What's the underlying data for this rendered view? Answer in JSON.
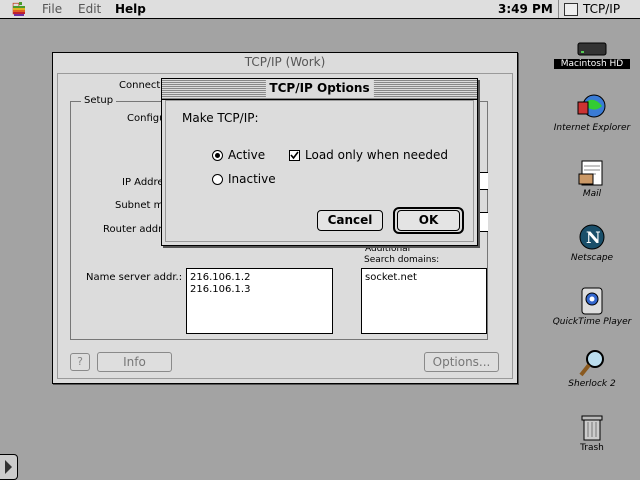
{
  "menubar": {
    "menus": [
      "File",
      "Edit",
      "Help"
    ],
    "clock": "3:49 PM",
    "active_app": "TCP/IP"
  },
  "main_window": {
    "title": "TCP/IP (Work)",
    "connect_label": "Connect v",
    "setup_label": "Setup",
    "configure_label": "Configu",
    "ip_address_label": "IP Addre",
    "subnet_mask_label": "Subnet ma",
    "router_address_label": "Router addre",
    "additional_label": "Additional",
    "search_domains_label": "Search domains:",
    "name_server_label": "Name server addr.:",
    "name_servers": [
      "216.106.1.2",
      "216.106.1.3"
    ],
    "search_domains": [
      "socket.net"
    ],
    "help_label": "?",
    "info_label": "Info",
    "options_label": "Options..."
  },
  "dialog": {
    "title": "TCP/IP Options",
    "prompt": "Make TCP/IP:",
    "radio_active": "Active",
    "radio_inactive": "Inactive",
    "selected": "Active",
    "checkbox_label": "Load only when needed",
    "checkbox_checked": true,
    "cancel_label": "Cancel",
    "ok_label": "OK"
  },
  "desktop_icons": [
    {
      "name": "Macintosh HD",
      "icon": "hard-disk-icon",
      "selected": true
    },
    {
      "name": "Internet Explorer",
      "icon": "internet-explorer-icon"
    },
    {
      "name": "Mail",
      "icon": "mail-icon"
    },
    {
      "name": "Netscape",
      "icon": "netscape-icon"
    },
    {
      "name": "QuickTime Player",
      "icon": "quicktime-icon"
    },
    {
      "name": "Sherlock 2",
      "icon": "sherlock-icon"
    },
    {
      "name": "Trash",
      "icon": "trash-icon"
    }
  ],
  "colors": {
    "desktop": "#a3a3a3",
    "window": "#dcdcdc",
    "apple_logo": "#c04020"
  }
}
